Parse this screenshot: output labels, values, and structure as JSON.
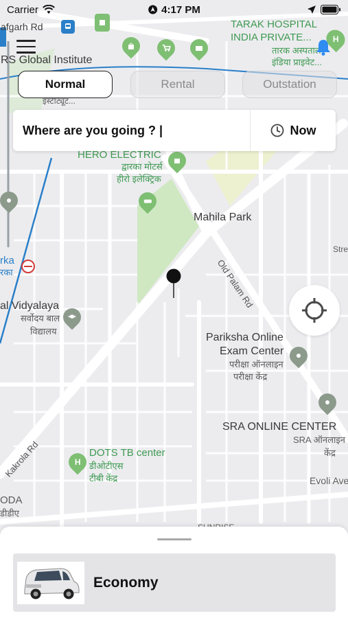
{
  "status_bar": {
    "carrier": "Carrier",
    "time": "4:17 PM"
  },
  "map": {
    "labels": {
      "top_road": "afgarh Rd",
      "rs_institute": "RS Global Institute",
      "tarak_hospital_1": "TARAK HOSPITAL",
      "tarak_hospital_2": "INDIA PRIVATE...",
      "tarak_hindi_1": "तारक अस्पताल",
      "tarak_hindi_2": "इंडिया प्राइवेट...",
      "institute_hindi": "इंस्टीट्यूट...",
      "hero_electric": "HERO ELECTRIC",
      "hero_hindi_1": "द्वारका मोटर्स",
      "hero_hindi_2": "हीरो इलेक्ट्रिक",
      "mahila_park": "Mahila Park",
      "old_palam_rd": "Old Palam Rd",
      "strip_right": "Stre",
      "dwarka_1": "rka",
      "dwarka_2": "रका",
      "vidyalaya": "al Vidyalaya",
      "vidyalaya_hindi_1": "सर्वोदय बाल",
      "vidyalaya_hindi_2": "विद्यालय",
      "pariksha_1": "Pariksha Online",
      "pariksha_2": "Exam Center",
      "pariksha_hindi_1": "परीक्षा ऑनलाइन",
      "pariksha_hindi_2": "परीक्षा केंद्र",
      "sra_center": "SRA ONLINE CENTER",
      "sra_hindi_1": "SRA ऑनलाइन",
      "sra_hindi_2": "केंद्र",
      "kakrola_rd": "Kakrola Rd",
      "dots_tb": "DOTS TB center",
      "dots_hindi_1": "डीओटीएस",
      "dots_hindi_2": "टीबी केंद्र",
      "evoli": "Evoli Ave",
      "oda": "ODA",
      "oda_hindi": "डीडीए",
      "sunrise": "SUNRISE"
    }
  },
  "mode_tabs": [
    {
      "label": "Normal",
      "selected": true
    },
    {
      "label": "Rental",
      "selected": false
    },
    {
      "label": "Outstation",
      "selected": false
    }
  ],
  "search": {
    "placeholder": "Where are you going ? |",
    "time_label": "Now"
  },
  "vehicles": [
    {
      "name": "Economy"
    }
  ],
  "colors": {
    "route_blue": "#2a7fc8",
    "poi_green": "#66bb6a",
    "park_green": "#cfe8c2",
    "accent_notification": "#2f8cf0"
  }
}
